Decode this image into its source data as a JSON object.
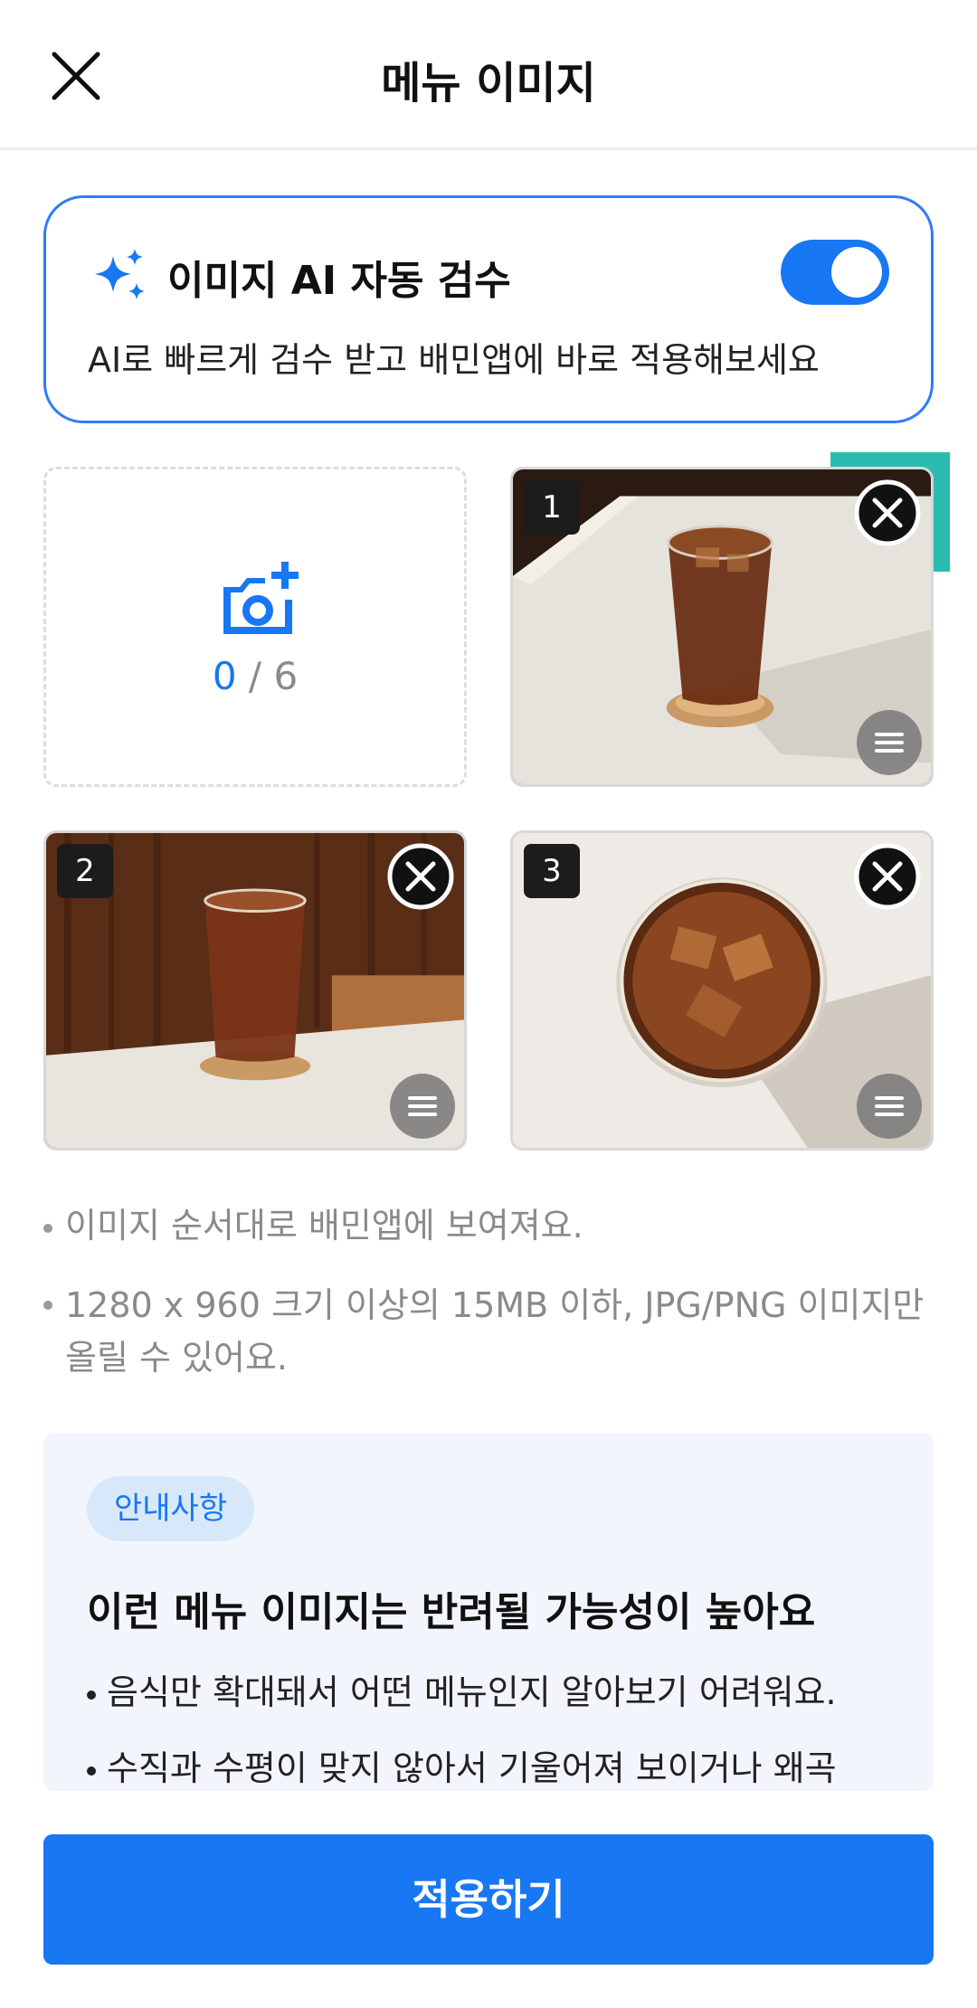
{
  "header": {
    "title": "메뉴 이미지"
  },
  "ai_review": {
    "title": "이미지 AI 자동 검수",
    "description": "AI로 빠르게 검수 받고 배민앱에 바로 적용해보세요",
    "toggle_on": true,
    "accent": "#1877f2"
  },
  "uploader": {
    "current": "0",
    "separator": "/",
    "max": "6"
  },
  "images": [
    {
      "index": "1",
      "subject": "iced coffee glass on coaster, table corner"
    },
    {
      "index": "2",
      "subject": "iced coffee glass on table, wooden wall background"
    },
    {
      "index": "3",
      "subject": "iced coffee glass from above"
    }
  ],
  "notes": [
    "이미지 순서대로 배민앱에 보여져요.",
    "1280 x 960 크기 이상의 15MB 이하, JPG/PNG 이미지만 올릴 수 있어요."
  ],
  "info": {
    "tag": "안내사항",
    "title": "이런 메뉴 이미지는 반려될 가능성이 높아요",
    "items": [
      "음식만 확대돼서 어떤 메뉴인지 알아보기 어려워요.",
      "수직과 수평이 맞지 않아서 기울어져 보이거나 왜곡"
    ]
  },
  "footer": {
    "apply_label": "적용하기"
  }
}
